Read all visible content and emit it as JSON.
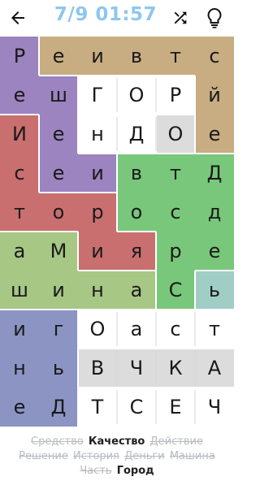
{
  "header": {
    "title": "7/9 01:57"
  },
  "icons": {
    "back": "back-arrow-icon",
    "shuffle": "shuffle-icon",
    "hint": "lightbulb-icon"
  },
  "grid": {
    "rows": [
      [
        "Р",
        "е",
        "и",
        "в",
        "т",
        "с"
      ],
      [
        "е",
        "ш",
        "Г",
        "О",
        "Р",
        "й"
      ],
      [
        "И",
        "е",
        "н",
        "Д",
        "О",
        "е"
      ],
      [
        "с",
        "е",
        "и",
        "в",
        "т",
        "Д"
      ],
      [
        "т",
        "о",
        "р",
        "о",
        "с",
        "д"
      ],
      [
        "а",
        "М",
        "и",
        "я",
        "р",
        "е"
      ],
      [
        "ш",
        "и",
        "н",
        "а",
        "С",
        "ь"
      ],
      [
        "и",
        "г",
        "О",
        "а",
        "с",
        "т"
      ],
      [
        "н",
        "ь",
        "В",
        "Ч",
        "К",
        "А"
      ],
      [
        "е",
        "Д",
        "Т",
        "С",
        "Е",
        "Ч"
      ]
    ]
  },
  "colors": {
    "purple": "#9b84bf",
    "tan": "#c8ad82",
    "red": "#c96f6f",
    "green": "#79c77b",
    "olive": "#a7c785",
    "lightgreen": "#a9d3ac",
    "blue": "#8c94c3",
    "white": "#ffffff",
    "grey": "#dcdcdc",
    "teal": "#a1cdc7"
  },
  "words": {
    "items": [
      {
        "text": "Средство",
        "found": true
      },
      {
        "text": "Качество",
        "found": false
      },
      {
        "text": "Действие",
        "found": true
      },
      {
        "text": "Решение",
        "found": true
      },
      {
        "text": "История",
        "found": true
      },
      {
        "text": "Деньги",
        "found": true
      },
      {
        "text": "Машина",
        "found": true
      },
      {
        "text": "Часть",
        "found": true
      },
      {
        "text": "Город",
        "found": false
      }
    ]
  }
}
